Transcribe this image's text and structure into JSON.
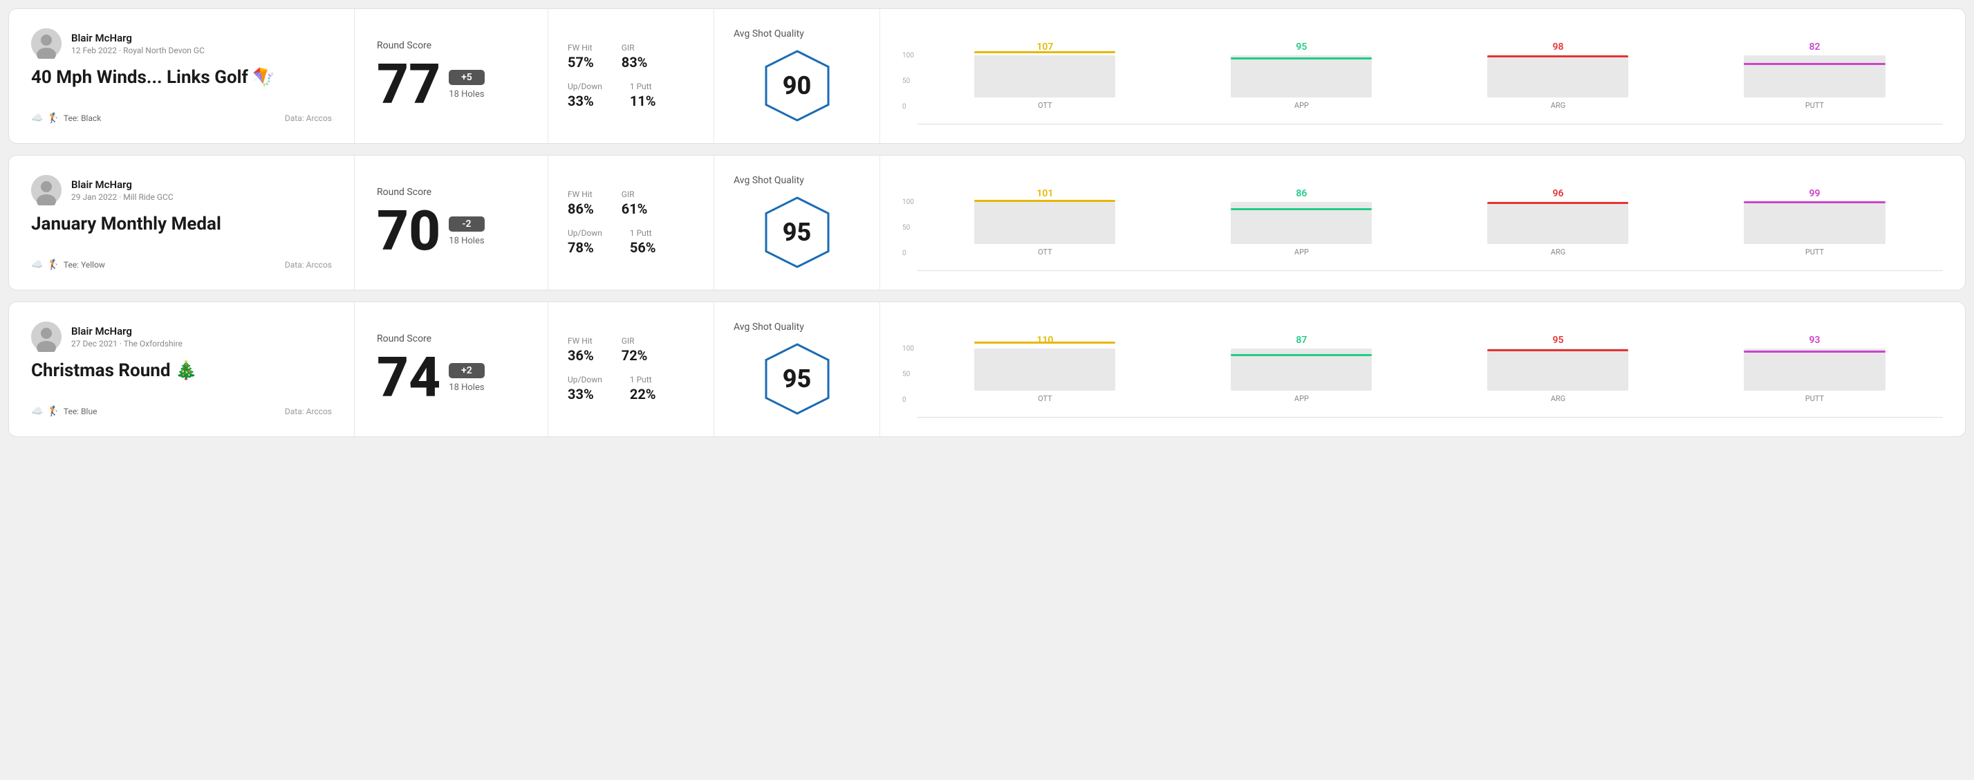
{
  "rounds": [
    {
      "id": "round1",
      "player": "Blair McHarg",
      "date": "12 Feb 2022",
      "course": "Royal North Devon GC",
      "title": "40 Mph Winds... Links Golf 🪁",
      "tee": "Black",
      "dataSource": "Data: Arccos",
      "score": 77,
      "scoreDiff": "+5",
      "scoreDiffType": "over",
      "holes": "18 Holes",
      "fwHit": "57%",
      "gir": "83%",
      "upDown": "33%",
      "onePutt": "11%",
      "avgShotQuality": 90,
      "chart": {
        "ott": {
          "value": 107,
          "color": "#e6b800",
          "barHeight": 75
        },
        "app": {
          "value": 95,
          "color": "#22cc88",
          "barHeight": 65
        },
        "arg": {
          "value": 98,
          "color": "#e63333",
          "barHeight": 68
        },
        "putt": {
          "value": 82,
          "color": "#cc44cc",
          "barHeight": 55
        }
      }
    },
    {
      "id": "round2",
      "player": "Blair McHarg",
      "date": "29 Jan 2022",
      "course": "Mill Ride GCC",
      "title": "January Monthly Medal",
      "tee": "Yellow",
      "dataSource": "Data: Arccos",
      "score": 70,
      "scoreDiff": "-2",
      "scoreDiffType": "under",
      "holes": "18 Holes",
      "fwHit": "86%",
      "gir": "61%",
      "upDown": "78%",
      "onePutt": "56%",
      "avgShotQuality": 95,
      "chart": {
        "ott": {
          "value": 101,
          "color": "#e6b800",
          "barHeight": 72
        },
        "app": {
          "value": 86,
          "color": "#22cc88",
          "barHeight": 58
        },
        "arg": {
          "value": 96,
          "color": "#e63333",
          "barHeight": 68
        },
        "putt": {
          "value": 99,
          "color": "#cc44cc",
          "barHeight": 70
        }
      }
    },
    {
      "id": "round3",
      "player": "Blair McHarg",
      "date": "27 Dec 2021",
      "course": "The Oxfordshire",
      "title": "Christmas Round 🎄",
      "tee": "Blue",
      "dataSource": "Data: Arccos",
      "score": 74,
      "scoreDiff": "+2",
      "scoreDiffType": "over",
      "holes": "18 Holes",
      "fwHit": "36%",
      "gir": "72%",
      "upDown": "33%",
      "onePutt": "22%",
      "avgShotQuality": 95,
      "chart": {
        "ott": {
          "value": 110,
          "color": "#e6b800",
          "barHeight": 80
        },
        "app": {
          "value": 87,
          "color": "#22cc88",
          "barHeight": 59
        },
        "arg": {
          "value": 95,
          "color": "#e63333",
          "barHeight": 67
        },
        "putt": {
          "value": 93,
          "color": "#cc44cc",
          "barHeight": 65
        }
      }
    }
  ],
  "labels": {
    "roundScore": "Round Score",
    "fwHit": "FW Hit",
    "gir": "GIR",
    "upDown": "Up/Down",
    "onePutt": "1 Putt",
    "avgShotQuality": "Avg Shot Quality",
    "ott": "OTT",
    "app": "APP",
    "arg": "ARG",
    "putt": "PUTT",
    "teePrefix": "Tee:",
    "chartY100": "100",
    "chartY50": "50",
    "chartY0": "0"
  }
}
